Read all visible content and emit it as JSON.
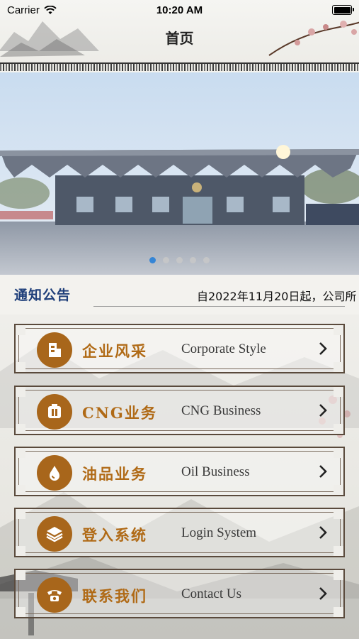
{
  "status_bar": {
    "carrier": "Carrier",
    "time": "10:20 AM"
  },
  "nav": {
    "title": "首页"
  },
  "banner": {
    "dot_count": 5,
    "active_index": 0
  },
  "notice": {
    "title": "通知公告",
    "text": "自2022年11月20日起，公司所"
  },
  "menu": [
    {
      "cn": "企业风采",
      "en": "Corporate Style",
      "icon": "building-icon"
    },
    {
      "cn": "CNG业务",
      "en": "CNG Business",
      "icon": "gas-tank-icon"
    },
    {
      "cn": "油品业务",
      "en": "Oil Business",
      "icon": "oil-drop-icon"
    },
    {
      "cn": "登入系统",
      "en": "Login System",
      "icon": "layers-icon"
    },
    {
      "cn": "联系我们",
      "en": "Contact Us",
      "icon": "phone-icon"
    }
  ],
  "colors": {
    "accent": "#a8661b",
    "active_dot": "#1e7bd8",
    "notice_title": "#1f3f7a"
  }
}
